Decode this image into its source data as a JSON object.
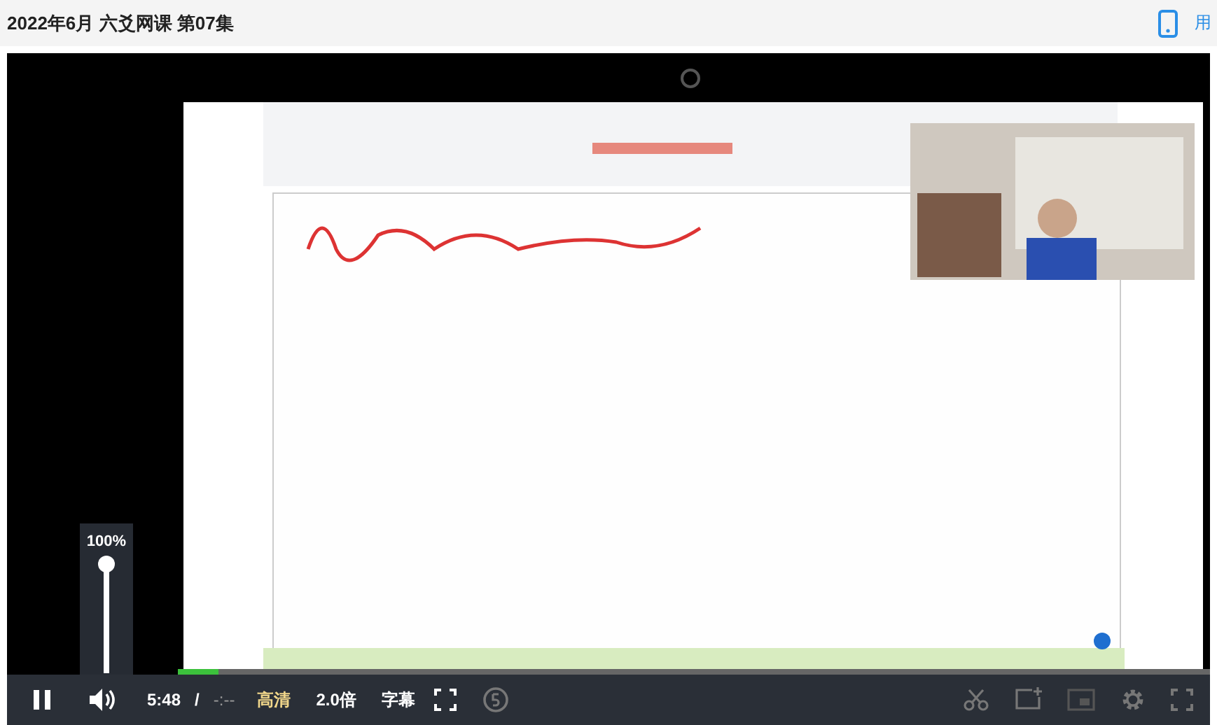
{
  "header": {
    "title": "2022年6月 六爻网课 第07集",
    "link": "用"
  },
  "volume_popup": {
    "reading": "100%",
    "level": 1
  },
  "progress": {
    "level": 0.04
  },
  "controls": {
    "playing": true,
    "time": "5:48",
    "separator": "/",
    "duration": "-:--",
    "quality": "高清",
    "speed": "2.0倍",
    "subtitles": "字幕"
  }
}
